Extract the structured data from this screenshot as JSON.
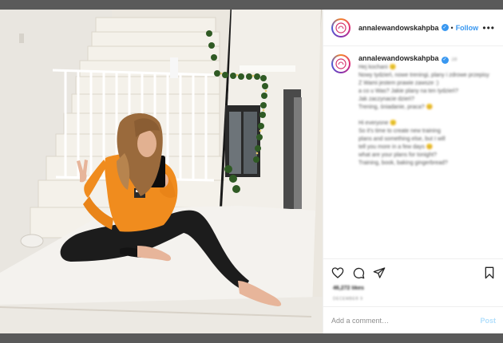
{
  "window": {
    "top_bar_color": "#5a5a5a",
    "bottom_bar_color": "#5a5a5a"
  },
  "header": {
    "username": "annalewandowskahpba",
    "verified_icon": "verified-badge-icon",
    "separator": "•",
    "follow_label": "Follow",
    "more_icon": "more-options-icon"
  },
  "caption": {
    "username": "annalewandowskahpba",
    "timestamp": "2d",
    "lines": [
      "Hej kochani 🙂",
      "Nowy tydzień, nowe treningi, plany i zdrowe przepisy",
      "Z Wami jestem prawie zawsze :)",
      "a co u Was? Jakie plany na ten tydzień?",
      "Jak zaczynacie dzień?",
      "Trening, śniadanie, praca? 😊",
      "",
      "Hi everyone 🙂",
      "So it's time to create new training",
      "plans and something else, but I will",
      "tell you more in a few days 😊",
      "what are your plans for tonight?",
      "Training, book, baking gingerbread?"
    ]
  },
  "actions": {
    "like_icon": "heart-icon",
    "comment_icon": "comment-icon",
    "share_icon": "share-icon",
    "save_icon": "bookmark-icon"
  },
  "likes_text": "46,272 likes",
  "post_time": "DECEMBER 9",
  "comment_box": {
    "placeholder": "Add a comment…",
    "post_label": "Post"
  },
  "colors": {
    "accent": "#3897f0",
    "post_disabled": "#b2dffc",
    "sweatshirt": "#f08c1e",
    "leggings": "#1c1c1c"
  }
}
